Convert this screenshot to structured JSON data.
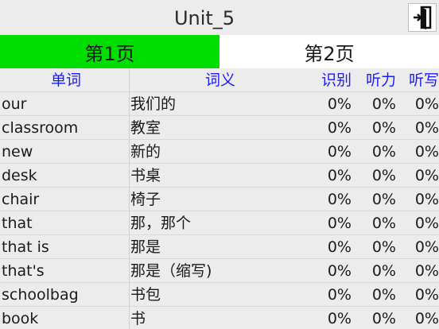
{
  "window": {
    "title": "Unit_5",
    "exit_icon": "exit-door-icon"
  },
  "tabs": [
    {
      "label": "第1页",
      "active": true
    },
    {
      "label": "第2页",
      "active": false
    }
  ],
  "table": {
    "headers": {
      "word": "单词",
      "meaning": "词义",
      "recognize": "识别",
      "listen": "听力",
      "dictation": "听写"
    },
    "rows": [
      {
        "word": "our",
        "meaning": "我们的",
        "recognize": "0%",
        "listen": "0%",
        "dictation": "0%"
      },
      {
        "word": "classroom",
        "meaning": "教室",
        "recognize": "0%",
        "listen": "0%",
        "dictation": "0%"
      },
      {
        "word": "new",
        "meaning": "新的",
        "recognize": "0%",
        "listen": "0%",
        "dictation": "0%"
      },
      {
        "word": "desk",
        "meaning": "书桌",
        "recognize": "0%",
        "listen": "0%",
        "dictation": "0%"
      },
      {
        "word": "chair",
        "meaning": "椅子",
        "recognize": "0%",
        "listen": "0%",
        "dictation": "0%"
      },
      {
        "word": "that",
        "meaning": "那，那个",
        "recognize": "0%",
        "listen": "0%",
        "dictation": "0%"
      },
      {
        "word": "that is",
        "meaning": "那是",
        "recognize": "0%",
        "listen": "0%",
        "dictation": "0%"
      },
      {
        "word": "that's",
        "meaning": "那是（缩写)",
        "recognize": "0%",
        "listen": "0%",
        "dictation": "0%"
      },
      {
        "word": "schoolbag",
        "meaning": "书包",
        "recognize": "0%",
        "listen": "0%",
        "dictation": "0%"
      },
      {
        "word": "book",
        "meaning": "书",
        "recognize": "0%",
        "listen": "0%",
        "dictation": "0%"
      }
    ]
  },
  "colors": {
    "active_tab": "#00dd00",
    "header_text": "#1a1aff",
    "background": "#ececec"
  }
}
